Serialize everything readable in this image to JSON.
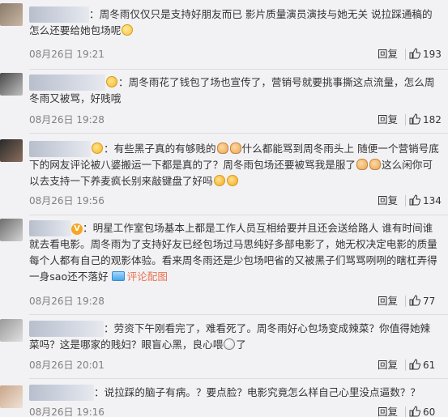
{
  "comments": [
    {
      "text": "周冬雨仅仅只是支持好朋友而已 影片质量演员演技与她无关 说拉踩通稿的怎么还要给她包场呢",
      "time": "08月26日 19:21",
      "reply_label": "回复",
      "likes": "193"
    },
    {
      "text": "周冬雨花了钱包了场也宣传了，营销号就要挑事撕这点流量，怎么周冬雨又被骂，好贱哦",
      "time": "08月26日 19:28",
      "reply_label": "回复",
      "likes": "182"
    },
    {
      "text_a": "有些黑子真的有够贱的",
      "text_b": "什么都能骂到周冬雨头上 随便一个营销号底下的网友评论被八婆搬运一下都是真的了？周冬雨包场还要被骂我是服了",
      "text_c": "这么闲你可以去支持一下养麦疯长别来敲键盘了好吗",
      "time": "08月26日 19:56",
      "reply_label": "回复",
      "likes": "134"
    },
    {
      "text": "明星工作室包场基本上都是工作人员互相给要并且还会送给路人 谁有时间谁就去看电影。周冬雨为了支持好友已经包场过马思纯好多部电影了，她无权决定电影的质量 每个人都有自己的观影体验。看来周冬雨还是少包场吧省的又被黑子们骂骂咧咧的瞎杠弄得一身sao还不落好",
      "badge": "V",
      "pic_label": "评论配图",
      "time": "08月26日 19:28",
      "reply_label": "回复",
      "likes": "77"
    },
    {
      "text_a": "劳资下午刚看完了，难看死了。周冬雨好心包场变成辣菜？你值得她辣菜吗？这是哪家的贱妇？眼盲心黑，良心喂",
      "text_b": "了",
      "time": "08月26日 20:01",
      "reply_label": "回复",
      "likes": "61"
    },
    {
      "text": "说拉踩的脑子有病。？要点脸？电影究竟怎么样自己心里没点逼数？？",
      "time": "08月26日 19:16",
      "reply_label": "回复",
      "likes": "60"
    }
  ],
  "colors": {
    "background": "#f2f2f5",
    "time": "#808080",
    "link": "#eb7350",
    "vip_badge": "#f5a623"
  },
  "icons": {
    "like": "thumbs-up-icon",
    "picture": "picture-icon",
    "emoji": "emoji-icon"
  }
}
